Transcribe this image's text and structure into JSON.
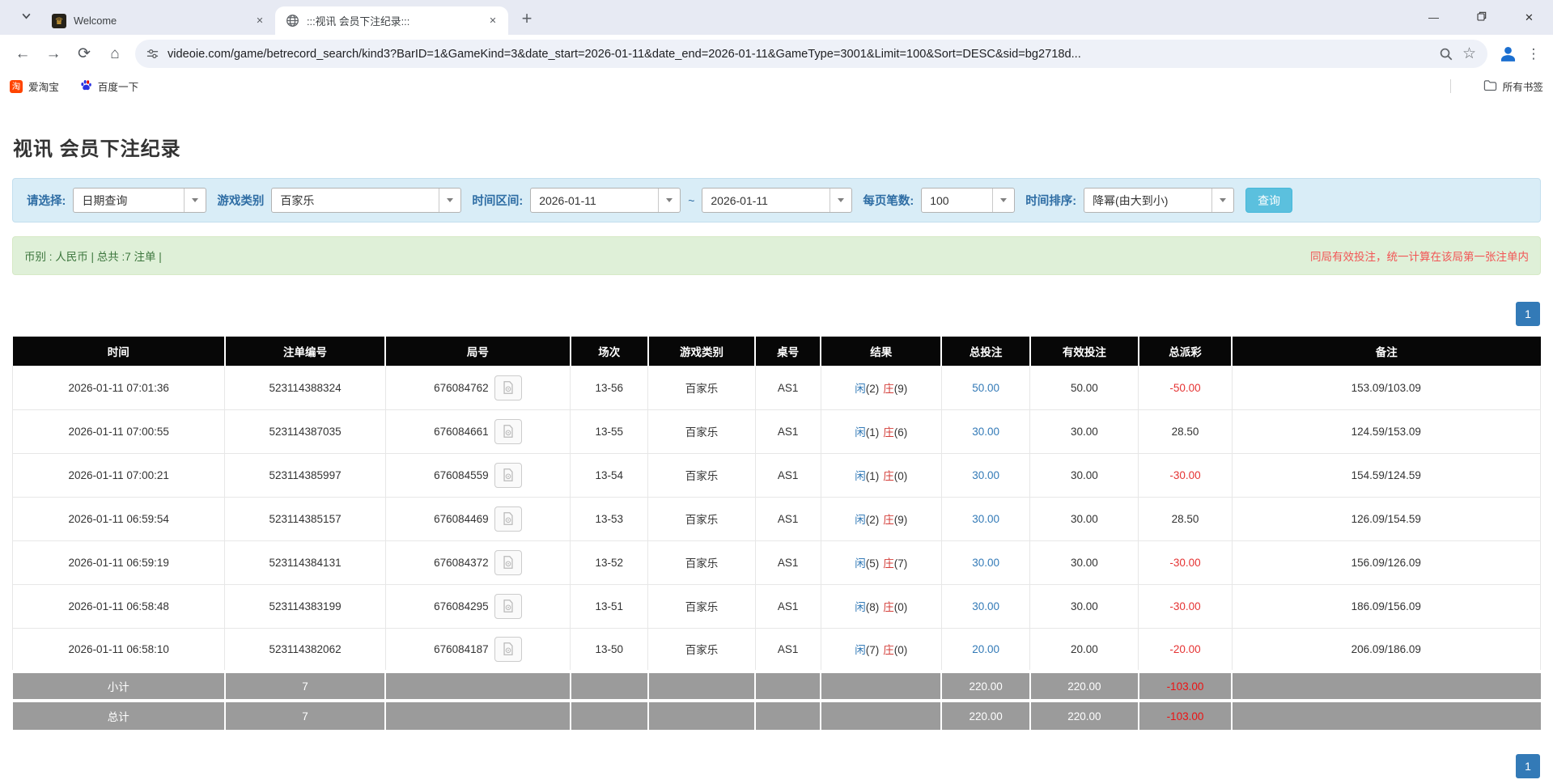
{
  "browser": {
    "tabs": [
      {
        "title": "Welcome"
      },
      {
        "title": ":::视讯 会员下注纪录:::"
      }
    ],
    "url": "videoie.com/game/betrecord_search/kind3?BarID=1&GameKind=3&date_start=2026-01-11&date_end=2026-01-11&GameType=3001&Limit=100&Sort=DESC&sid=bg2718d...",
    "bookmarks": [
      {
        "label": "爱淘宝"
      },
      {
        "label": "百度一下"
      }
    ],
    "all_bookmarks_label": "所有书签"
  },
  "glyphs": {
    "close": "✕",
    "minimize": "—",
    "plus": "+",
    "star": "☆",
    "back": "←",
    "forward": "→",
    "reload": "⟳",
    "home": "⌂",
    "menu": "⋮",
    "taobao_badge": "淘",
    "welcome_favicon": "♛"
  },
  "page": {
    "title": "视讯 会员下注纪录",
    "filters": {
      "select_label": "请选择:",
      "select_value": "日期查询",
      "game_kind_label": "游戏类别",
      "game_kind_value": "百家乐",
      "date_range_label": "时间区间:",
      "date_start": "2026-01-11",
      "date_tilde": "~",
      "date_end": "2026-01-11",
      "per_page_label": "每页笔数:",
      "per_page_value": "100",
      "sort_label": "时间排序:",
      "sort_value": "降幂(由大到小)",
      "search_button": "查询"
    },
    "summary": {
      "left": "币别 : 人民币 | 总共 :7 注单 |",
      "right": "同局有效投注，统一计算在该局第一张注单内"
    },
    "pagination": {
      "page": "1"
    },
    "table": {
      "headers": [
        "时间",
        "注单编号",
        "局号",
        "场次",
        "游戏类别",
        "桌号",
        "结果",
        "总投注",
        "有效投注",
        "总派彩",
        "备注"
      ],
      "rows": [
        {
          "time": "2026-01-11 07:01:36",
          "bet_id": "523114388324",
          "round": "676084762",
          "session": "13-56",
          "game": "百家乐",
          "table": "AS1",
          "result_player": "闲",
          "result_player_num": "(2)",
          "result_banker": "庄",
          "result_banker_num": "(9)",
          "total_bet": "50.00",
          "valid_bet": "50.00",
          "payout": "-50.00",
          "note": "153.09/103.09"
        },
        {
          "time": "2026-01-11 07:00:55",
          "bet_id": "523114387035",
          "round": "676084661",
          "session": "13-55",
          "game": "百家乐",
          "table": "AS1",
          "result_player": "闲",
          "result_player_num": "(1)",
          "result_banker": "庄",
          "result_banker_num": "(6)",
          "total_bet": "30.00",
          "valid_bet": "30.00",
          "payout": "28.50",
          "note": "124.59/153.09"
        },
        {
          "time": "2026-01-11 07:00:21",
          "bet_id": "523114385997",
          "round": "676084559",
          "session": "13-54",
          "game": "百家乐",
          "table": "AS1",
          "result_player": "闲",
          "result_player_num": "(1)",
          "result_banker": "庄",
          "result_banker_num": "(0)",
          "total_bet": "30.00",
          "valid_bet": "30.00",
          "payout": "-30.00",
          "note": "154.59/124.59"
        },
        {
          "time": "2026-01-11 06:59:54",
          "bet_id": "523114385157",
          "round": "676084469",
          "session": "13-53",
          "game": "百家乐",
          "table": "AS1",
          "result_player": "闲",
          "result_player_num": "(2)",
          "result_banker": "庄",
          "result_banker_num": "(9)",
          "total_bet": "30.00",
          "valid_bet": "30.00",
          "payout": "28.50",
          "note": "126.09/154.59"
        },
        {
          "time": "2026-01-11 06:59:19",
          "bet_id": "523114384131",
          "round": "676084372",
          "session": "13-52",
          "game": "百家乐",
          "table": "AS1",
          "result_player": "闲",
          "result_player_num": "(5)",
          "result_banker": "庄",
          "result_banker_num": "(7)",
          "total_bet": "30.00",
          "valid_bet": "30.00",
          "payout": "-30.00",
          "note": "156.09/126.09"
        },
        {
          "time": "2026-01-11 06:58:48",
          "bet_id": "523114383199",
          "round": "676084295",
          "session": "13-51",
          "game": "百家乐",
          "table": "AS1",
          "result_player": "闲",
          "result_player_num": "(8)",
          "result_banker": "庄",
          "result_banker_num": "(0)",
          "total_bet": "30.00",
          "valid_bet": "30.00",
          "payout": "-30.00",
          "note": "186.09/156.09"
        },
        {
          "time": "2026-01-11 06:58:10",
          "bet_id": "523114382062",
          "round": "676084187",
          "session": "13-50",
          "game": "百家乐",
          "table": "AS1",
          "result_player": "闲",
          "result_player_num": "(7)",
          "result_banker": "庄",
          "result_banker_num": "(0)",
          "total_bet": "20.00",
          "valid_bet": "20.00",
          "payout": "-20.00",
          "note": "206.09/186.09"
        }
      ],
      "subtotal": {
        "label": "小计",
        "count": "7",
        "total_bet": "220.00",
        "valid_bet": "220.00",
        "payout": "-103.00"
      },
      "total": {
        "label": "总计",
        "count": "7",
        "total_bet": "220.00",
        "valid_bet": "220.00",
        "payout": "-103.00"
      }
    }
  },
  "colors": {
    "accent_blue": "#337ab7",
    "button_cyan": "#5bc0de",
    "filter_panel_blue": "#d9edf7",
    "summary_green_bg": "#dff0d8",
    "summary_green_text": "#3c763d",
    "notice_red": "#f25555",
    "negative_red": "#e53333",
    "header_black": "#070707",
    "footer_gray": "#9b9b9b",
    "player_blue": "#337ab7",
    "banker_red": "#d43f3a"
  }
}
